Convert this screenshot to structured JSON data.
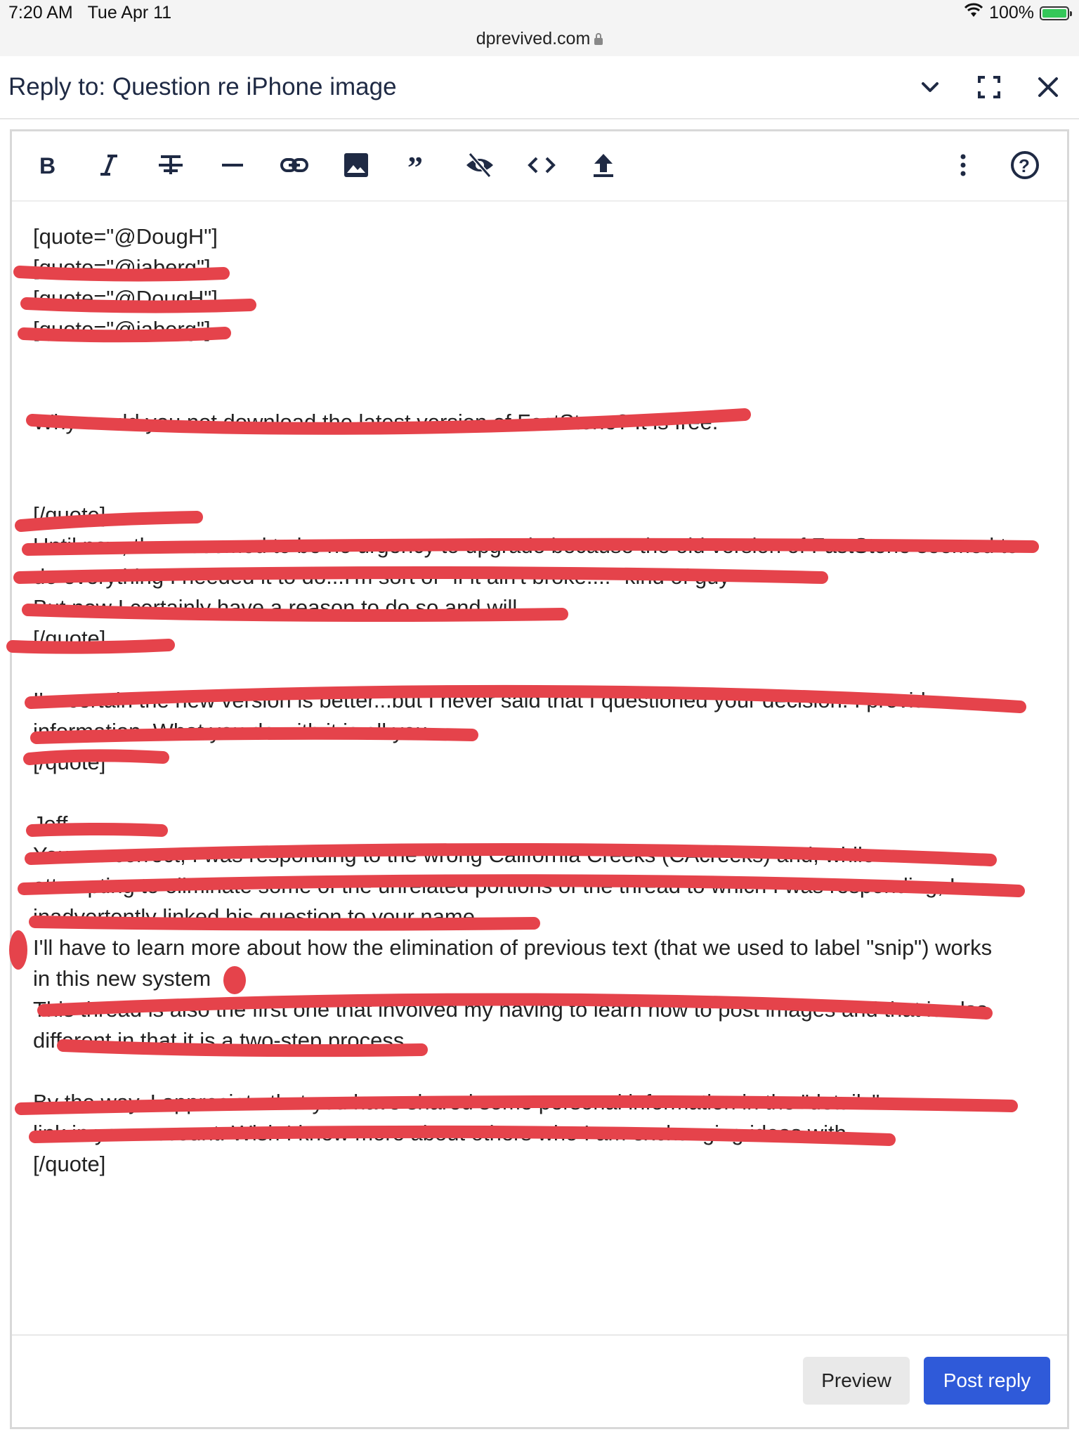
{
  "status_bar": {
    "time": "7:20 AM",
    "date": "Tue Apr 11",
    "url": "dprevived.com",
    "battery": "100%",
    "wifi_icon": "wifi-icon",
    "battery_icon": "battery-charging-icon"
  },
  "header": {
    "title": "Reply to: Question re iPhone image",
    "icons": [
      "chevron-down-icon",
      "fullscreen-icon",
      "close-icon"
    ]
  },
  "toolbar": {
    "icons": [
      "bold-icon",
      "italic-icon",
      "strikethrough-icon",
      "horizontal-rule-icon",
      "link-icon",
      "image-icon",
      "quote-icon",
      "hide-icon",
      "code-icon",
      "upload-icon",
      "more-icon",
      "help-icon"
    ]
  },
  "editor": {
    "lines": [
      "[quote=\"@DougH\"]",
      "[quote=\"@jaberg\"]",
      "[quote=\"@DougH\"]",
      "[quote=\"@jaberg\"]",
      "",
      "",
      "Why would you not download the latest version of FastStone? It is free.",
      "",
      "",
      "[/quote]",
      "Until now, there seemed to be no urgency to upgrade because the old version of FastStone seemed to",
      "do everything I needed it to do...I'm sort of \"if it ain't broke....\" kind of guy",
      "But now I certainly have a reason to do so and will",
      "[/quote]",
      "",
      "I'm certain the new version is better...but I never said that I questioned your decision. I provide",
      "information. What you do with it is all you.",
      "[/quote]",
      "",
      "Jeff",
      "You are correct, I was responding to the wrong California Creeks (CAcreeks) and, while",
      "attempting to eliminate some of the unrelated portions of the thread to which I was responding, I",
      "inadvertently linked his question to your name.",
      "I'll have to learn more about how the elimination of previous text (that we used to label \"snip\") works",
      "in this new system",
      "This thread is also the first one that involved my having to learn how to post images and that is also",
      "different in that it is a two-step process.",
      "",
      "By the way, I appreciate that you have shared some personal information in the \"details\"",
      "link in your account. Wish I knew more about others who I am exchanging ideas with.",
      "[/quote]"
    ]
  },
  "footer": {
    "preview_label": "Preview",
    "post_label": "Post reply"
  },
  "colors": {
    "accent": "#2f5ad9",
    "redaction": "#e5434b",
    "title_text": "#1f2a44"
  }
}
